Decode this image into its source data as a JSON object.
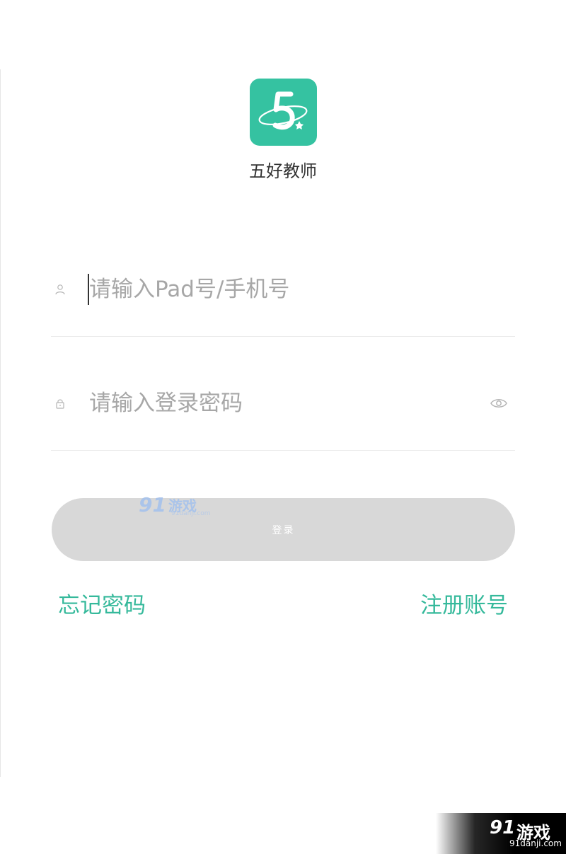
{
  "app": {
    "name": "五好教师",
    "accent_color": "#35c2a1"
  },
  "form": {
    "account": {
      "placeholder": "请输入Pad号/手机号",
      "value": "",
      "icon": "user-icon"
    },
    "password": {
      "placeholder": "请输入登录密码",
      "value": "",
      "icon": "lock-icon",
      "toggle_icon": "eye-icon"
    },
    "login_label": "登录",
    "login_enabled": false
  },
  "links": {
    "forgot": "忘记密码",
    "register": "注册账号",
    "color": "#35b99b"
  },
  "watermark": {
    "number": "91",
    "brand": "游戏",
    "url": "91danji.com"
  }
}
